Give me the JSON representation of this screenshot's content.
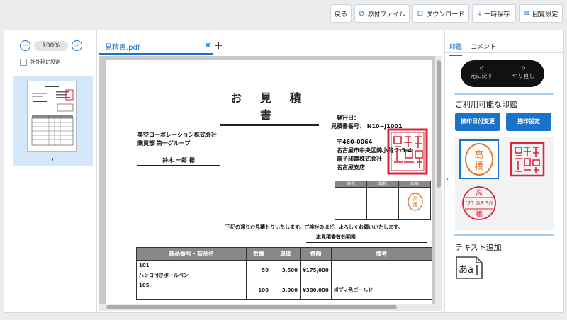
{
  "toolbar": {
    "back": "戻る",
    "attach": "添付ファイル",
    "download": "ダウンロード",
    "save_temp": "一時保存",
    "reply_settings": "回覧設定"
  },
  "left_panel": {
    "zoom_minus": "−",
    "zoom_value": "100%",
    "zoom_plus": "+",
    "confidential_label": "社外秘に設定",
    "thumbnail_page_number": "1"
  },
  "file_tabs": {
    "tab_label": "見積書.pdf",
    "close": "×",
    "add": "+"
  },
  "document": {
    "title": "お 見 積 書",
    "issue_date_label": "発行日：",
    "estimate_number": "見積書番号： N10−J1001",
    "client_company": "美空コーポレーション株式会社",
    "client_department": "購買部 第一グループ",
    "client_person": "鈴木 一郎 様",
    "postal_code": "〒460-0064",
    "address": "名古屋市中央区錦小路 2-3-4",
    "sender_company": "電子印鑑株式会社",
    "sender_branch": "名古屋支店",
    "approval_headers": [
      "部長",
      "課長",
      "担当"
    ],
    "approval_stamp": "高橋",
    "notice": "下記の通りお見積もりいたします。ご検討のほど、よろしくお願いいたします。",
    "validity_label": "本見積書有効期限",
    "table_headers": [
      "商品番号・商品名",
      "数量",
      "単価",
      "金額",
      "備考"
    ],
    "rows": [
      {
        "code": "101",
        "name": "ハンコ付きボールペン",
        "qty": "50",
        "unit_price": "3,500",
        "amount": "¥175,000",
        "note": ""
      },
      {
        "code": "105",
        "name": "",
        "qty": "100",
        "unit_price": "3,000",
        "amount": "¥300,000",
        "note": "ボディ色ゴールド"
      }
    ],
    "corp_seal_text": "電子印鑑株式会社之印"
  },
  "right_panel": {
    "tab_stamp": "印鑑",
    "tab_comment": "コメント",
    "undo_label": "元に戻す",
    "redo_label": "やり直し",
    "available_stamps_title": "ご利用可能な印鑑",
    "date_stamp_btn": "捺印日付変更",
    "stamp_settings_btn": "捺印設定",
    "stamp_name": "高橋",
    "date_stamp_name_top": "高",
    "date_stamp_date": "'21.08.30",
    "date_stamp_name_bottom": "橋",
    "text_add_title": "テキスト追加",
    "text_tool_label": "あa"
  },
  "colors": {
    "accent": "#1a73c8",
    "stamp_red": "#d9263a",
    "stamp_orange": "#e07a2a"
  }
}
